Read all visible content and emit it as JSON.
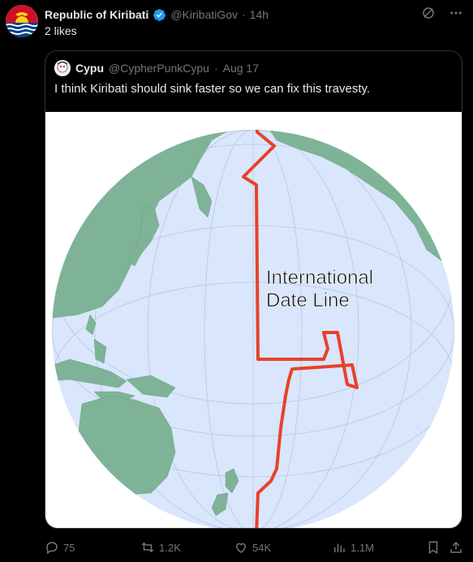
{
  "tweet": {
    "display_name": "Republic of Kiribati",
    "handle": "@KiribatiGov",
    "separator": "·",
    "time": "14h",
    "likes_text": "2 likes"
  },
  "quote": {
    "display_name": "Cypu",
    "handle": "@CypherPunkCypu",
    "separator": "·",
    "date": "Aug 17",
    "text": "I think Kiribati should sink faster so we can fix this travesty.",
    "map_label_line1": "International",
    "map_label_line2": "Date Line"
  },
  "actions": {
    "replies": "75",
    "reposts": "1.2K",
    "likes": "54K",
    "views": "1.1M"
  },
  "icons": [
    "verified-badge-icon",
    "grok-icon",
    "more-icon",
    "reply-icon",
    "repost-icon",
    "like-icon",
    "views-icon",
    "bookmark-icon",
    "share-icon"
  ],
  "colors": {
    "background": "#000000",
    "text": "#e7e9ea",
    "muted": "#71767b",
    "verified": "#1d9bf0",
    "ocean": "#d9e6fb",
    "land": "#7fb397",
    "date_line": "#e8412b"
  }
}
